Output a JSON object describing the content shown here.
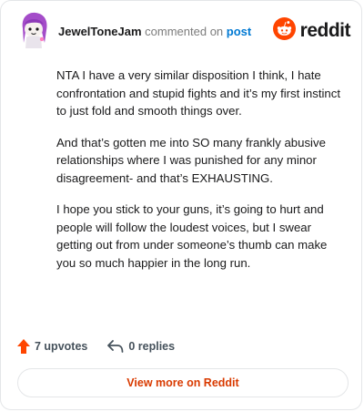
{
  "comment": {
    "author": "JewelToneJam",
    "action_text": "commented on",
    "post_link": "post",
    "paragraphs": [
      "NTA I have a very similar disposition I think, I hate confrontation and stupid fights and it’s my first instinct to just fold and smooth things over.",
      "And that’s gotten me into SO many frankly abusive relationships where I was punished for any minor disagreement- and that’s EXHAUSTING.",
      "I hope you stick to your guns, it’s going to hurt and people will follow the loudest voices, but I swear getting out from under someone’s thumb can make you so much happier in the long run."
    ],
    "upvotes": "7 upvotes",
    "replies": "0 replies"
  },
  "brand": {
    "name": "reddit",
    "color": "#ff4500"
  },
  "view_more_label": "View more on Reddit",
  "icons": {
    "avatar": "snoo-avatar-purple-hair",
    "brand": "reddit-logo-icon",
    "upvote": "upvote-arrow-icon",
    "reply": "reply-arrow-icon"
  },
  "colors": {
    "accent": "#d93a00",
    "link": "#0079d3",
    "upvote": "#ff4500"
  }
}
